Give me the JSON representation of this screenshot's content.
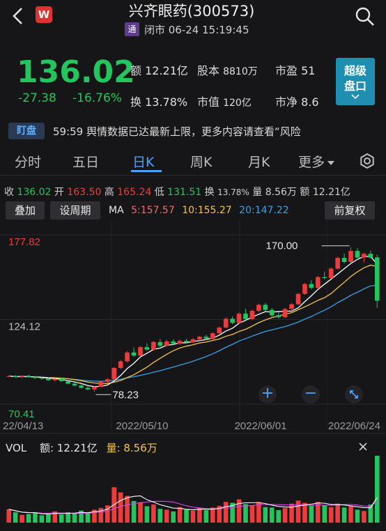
{
  "header": {
    "title": "兴齐眼药(300573)",
    "badge": "通",
    "status": "闭市 06-24 15:19:45",
    "logo": "W"
  },
  "quote": {
    "price": "136.02",
    "change": "-27.38",
    "change_pct": "-16.76%",
    "turnover_label": "额",
    "turnover": "12.21亿",
    "share_capital_label": "股本",
    "share_capital": "8810万",
    "pe_label": "市盈",
    "pe": "51",
    "turnover_rate_label": "换",
    "turnover_rate": "13.78%",
    "market_cap_label": "市值",
    "market_cap": "120亿",
    "pb_label": "市净",
    "pb": "8.6",
    "super_button": [
      "超级",
      "盘口"
    ]
  },
  "news": {
    "tag": "盯盘",
    "text": "59:59 舆情数据已达最新上限，更多内容请查看“风险"
  },
  "tabs": [
    "分时",
    "五日",
    "日K",
    "周K",
    "月K",
    "更多"
  ],
  "active_tab": "日K",
  "ohlc": {
    "close_label": "收",
    "close": "136.02",
    "open_label": "开",
    "open": "163.50",
    "high_label": "高",
    "high": "165.24",
    "low_label": "低",
    "low": "131.51",
    "turn_label": "换",
    "turn": "13.78%",
    "vol_label": "量",
    "vol": "8.56万",
    "amt_label": "额",
    "amt": "12.21亿"
  },
  "controls": {
    "overlay": "叠加",
    "period": "设周期",
    "adjust": "前复权",
    "ma_label": "MA",
    "ma5": "5:157.57",
    "ma10": "10:155.27",
    "ma20": "20:147.22"
  },
  "vol_panel": {
    "label": "VOL",
    "amt_label": "额:",
    "amt": "12.21亿",
    "vol_label": "量:",
    "vol": "8.56万"
  },
  "colors": {
    "up": "#ef3b3b",
    "down": "#22c55e",
    "ma5": "#ffffff",
    "ma10": "#f5c542",
    "ma20": "#3aa0e8",
    "accent": "#4aa3ff"
  },
  "chart_data": {
    "type": "candlestick",
    "y_labels": [
      "177.82",
      "124.12",
      "70.41"
    ],
    "ylim": [
      70.41,
      177.82
    ],
    "x_labels": [
      "22/04/13",
      "2022/05/10",
      "2022/06/01",
      "2022/06/24"
    ],
    "annotations": {
      "high": "170.00",
      "low": "78.23"
    },
    "candles": [
      [
        87.8,
        88.6,
        87.6,
        88.2
      ],
      [
        88.2,
        88.8,
        87.2,
        87.6
      ],
      [
        87.6,
        88.6,
        86.8,
        88.0
      ],
      [
        88.0,
        89.2,
        87.4,
        87.8
      ],
      [
        87.8,
        88.4,
        86.6,
        87.0
      ],
      [
        87.0,
        87.8,
        86.0,
        86.6
      ],
      [
        86.6,
        87.4,
        85.2,
        85.6
      ],
      [
        85.6,
        87.0,
        84.8,
        86.4
      ],
      [
        86.4,
        87.2,
        84.6,
        85.0
      ],
      [
        85.0,
        85.8,
        83.0,
        83.4
      ],
      [
        83.4,
        84.4,
        81.6,
        82.2
      ],
      [
        82.2,
        83.0,
        80.4,
        80.8
      ],
      [
        80.8,
        81.6,
        79.2,
        79.8
      ],
      [
        79.8,
        82.0,
        78.23,
        81.4
      ],
      [
        81.4,
        85.0,
        80.8,
        84.6
      ],
      [
        84.6,
        87.0,
        83.8,
        86.2
      ],
      [
        86.2,
        94.0,
        85.8,
        93.4
      ],
      [
        93.4,
        98.4,
        92.6,
        97.6
      ],
      [
        97.6,
        104.0,
        96.8,
        103.2
      ],
      [
        103.2,
        106.4,
        100.4,
        101.2
      ],
      [
        101.2,
        107.4,
        100.6,
        106.6
      ],
      [
        106.6,
        109.0,
        104.2,
        105.0
      ],
      [
        105.0,
        110.6,
        104.4,
        109.8
      ],
      [
        109.8,
        111.8,
        106.6,
        107.4
      ],
      [
        107.4,
        111.2,
        106.8,
        110.2
      ],
      [
        110.2,
        111.6,
        108.2,
        108.8
      ],
      [
        108.8,
        111.4,
        108.0,
        110.6
      ],
      [
        110.6,
        112.0,
        109.0,
        109.6
      ],
      [
        109.6,
        112.4,
        109.0,
        111.6
      ],
      [
        111.6,
        113.8,
        110.8,
        113.2
      ],
      [
        113.2,
        114.4,
        111.0,
        111.8
      ],
      [
        111.8,
        116.0,
        111.4,
        115.4
      ],
      [
        115.4,
        119.8,
        114.8,
        119.0
      ],
      [
        119.0,
        125.4,
        118.6,
        124.6
      ],
      [
        124.6,
        126.2,
        121.2,
        122.0
      ],
      [
        122.0,
        128.6,
        121.6,
        127.8
      ],
      [
        127.8,
        131.0,
        123.6,
        124.4
      ],
      [
        124.4,
        130.4,
        123.8,
        129.6
      ],
      [
        129.6,
        134.2,
        128.8,
        133.4
      ],
      [
        133.4,
        134.6,
        129.4,
        130.2
      ],
      [
        130.2,
        131.4,
        125.6,
        126.8
      ],
      [
        126.8,
        128.6,
        124.8,
        125.6
      ],
      [
        125.6,
        131.4,
        125.0,
        130.8
      ],
      [
        130.8,
        134.6,
        130.0,
        133.8
      ],
      [
        133.8,
        141.0,
        133.2,
        140.4
      ],
      [
        140.4,
        147.4,
        139.8,
        146.6
      ],
      [
        146.6,
        149.0,
        143.2,
        144.2
      ],
      [
        144.2,
        151.8,
        143.8,
        151.0
      ],
      [
        151.0,
        154.6,
        149.6,
        150.4
      ],
      [
        150.4,
        157.2,
        149.8,
        156.4
      ],
      [
        156.4,
        164.0,
        155.8,
        163.2
      ],
      [
        163.2,
        166.0,
        159.8,
        160.6
      ],
      [
        160.6,
        170.0,
        160.0,
        167.6
      ],
      [
        167.6,
        169.4,
        162.0,
        163.4
      ],
      [
        163.4,
        166.6,
        160.2,
        165.8
      ],
      [
        165.8,
        167.8,
        162.8,
        163.4
      ],
      [
        163.5,
        165.24,
        131.51,
        136.02
      ]
    ],
    "volume": [
      3.1,
      2.4,
      1.8,
      2.0,
      2.3,
      1.7,
      2.1,
      2.6,
      1.9,
      2.4,
      2.1,
      2.8,
      2.3,
      3.0,
      3.4,
      4.0,
      8.2,
      7.0,
      6.2,
      5.0,
      4.6,
      3.8,
      4.2,
      3.2,
      3.0,
      2.6,
      3.6,
      3.0,
      2.8,
      3.4,
      2.9,
      3.5,
      3.9,
      4.8,
      4.6,
      5.4,
      4.3,
      4.0,
      4.8,
      3.6,
      3.5,
      2.9,
      3.4,
      4.4,
      5.1,
      4.6,
      3.9,
      4.8,
      4.1,
      3.6,
      4.4,
      3.5,
      3.8,
      3.0,
      2.7,
      4.2,
      15.5
    ]
  }
}
